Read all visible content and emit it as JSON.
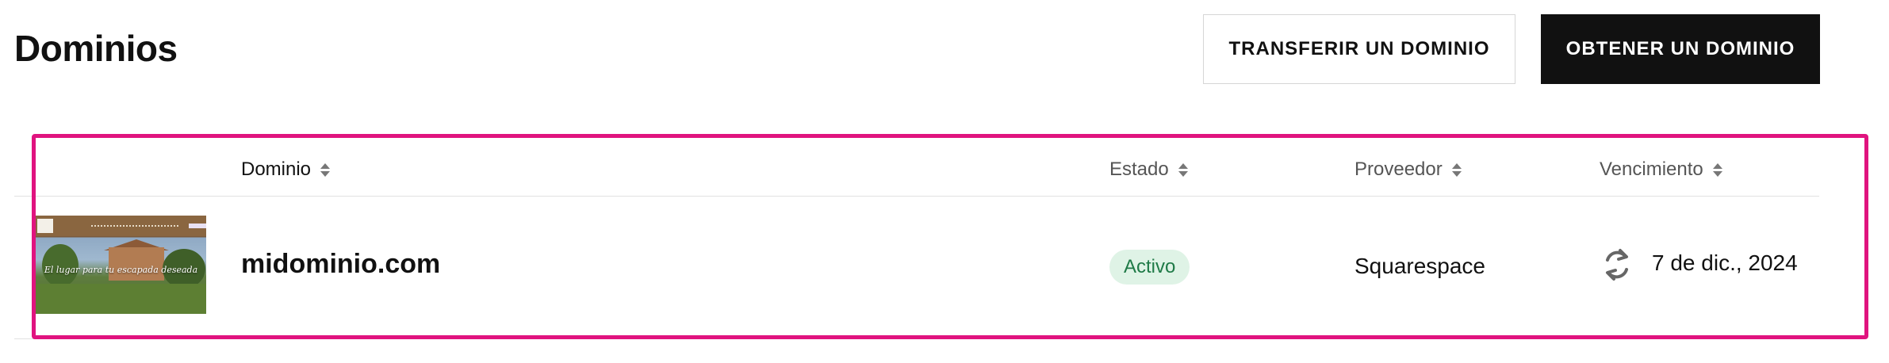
{
  "header": {
    "title": "Dominios",
    "transfer_button": "TRANSFERIR UN DOMINIO",
    "get_button": "OBTENER UN DOMINIO"
  },
  "table": {
    "columns": [
      "Dominio",
      "Estado",
      "Proveedor",
      "Vencimiento"
    ],
    "rows": [
      {
        "thumbnail_text": "El lugar para tu escapada deseada",
        "domain": "midominio.com",
        "status": "Activo",
        "provider": "Squarespace",
        "renew_icon": "auto-renew-icon",
        "expiry": "7 de dic., 2024"
      }
    ]
  },
  "colors": {
    "highlight": "#e0137f",
    "status_bg": "#dff3e6",
    "status_text": "#1f7a47",
    "primary_button": "#111111"
  }
}
